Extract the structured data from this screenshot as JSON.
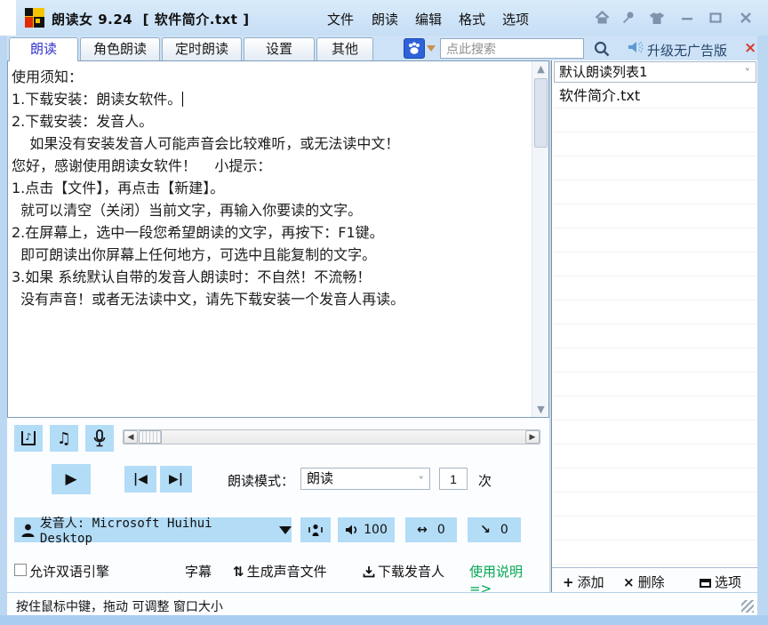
{
  "window": {
    "title": "朗读女 9.24  [ 软件简介.txt ]"
  },
  "menubar": {
    "items": [
      "文件",
      "朗读",
      "编辑",
      "格式",
      "选项"
    ]
  },
  "tabs": {
    "items": [
      "朗读",
      "角色朗读",
      "定时朗读",
      "设置",
      "其他"
    ],
    "active": "朗读"
  },
  "search": {
    "placeholder": "点此搜索",
    "upgrade_label": "升级无广告版",
    "upgrade_close": "×"
  },
  "editor": {
    "caret_after_line": 1,
    "lines": [
      "使用须知：",
      "1.下载安装：朗读女软件。",
      "2.下载安装：发音人。",
      "    如果没有安装发音人可能声音会比较难听，或无法读中文！",
      "",
      "您好，感谢使用朗读女软件！    小提示：",
      "",
      "1.点击【文件】，再点击【新建】。",
      "  就可以清空（关闭）当前文字，再输入你要读的文字。",
      "",
      "2.在屏幕上，选中一段您希望朗读的文字，再按下：F1键。",
      "  即可朗读出你屏幕上任何地方，可选中且能复制的文字。",
      "",
      "3.如果 系统默认自带的发音人朗读时：不自然！不流畅！",
      "  没有声音！或者无法读中文，请先下载安装一个发音人再读。"
    ]
  },
  "playlist": {
    "selector_value": "默认朗读列表1",
    "items": [
      "软件简介.txt"
    ],
    "empty_rows": 19,
    "add_label": "添加",
    "delete_label": "删除",
    "options_label": "选项",
    "add_sym": "+",
    "delete_sym": "×"
  },
  "controls": {
    "note_glyph": "♪",
    "note2_glyph": "♫",
    "play_glyph": "▶",
    "prev_glyph": "|◀",
    "next_glyph": "▶|",
    "mode_label": "朗读模式：",
    "mode_value": "朗读",
    "repeat_value": "1",
    "repeat_unit": "次",
    "voice_label": "发音人: Microsoft Huihui Desktop",
    "volume_value": "100",
    "rate_glyph": "↔",
    "rate_value": "0",
    "pitch_glyph": "↘",
    "pitch_value": "0",
    "bilingual_label": "允许双语引擎",
    "subtitle_label": "字幕",
    "export_sym": "⇅",
    "export_label": "生成声音文件",
    "download_label": "下载发音人",
    "help_label": "使用说明 =>"
  },
  "statusbar": {
    "text": "按住鼠标中键，拖动 可调整 窗口大小"
  },
  "colors": {
    "button_blue": "#b3dcf7",
    "frame_blue": "#c3dcf3",
    "active_tab_text": "#3232cd",
    "upgrade_close_red": "#d93a2e",
    "help_green": "#00a651",
    "logo_yellow": "#f5c400",
    "logo_red": "#e02a00"
  }
}
